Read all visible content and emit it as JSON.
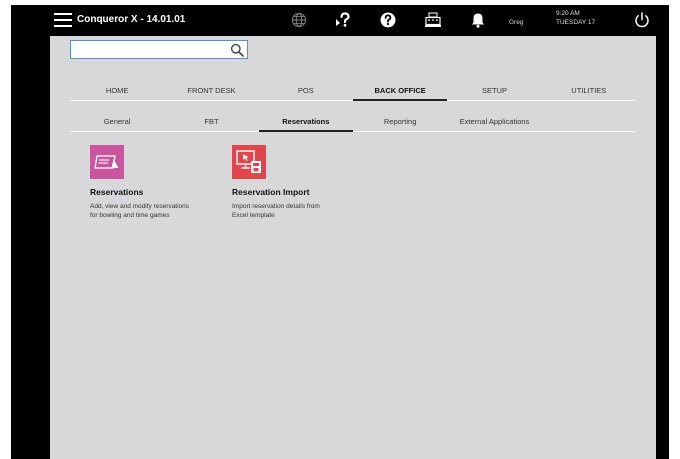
{
  "app": {
    "title": "Conqueror X - 14.01.01"
  },
  "topbar": {
    "user_name": "Greg",
    "time": "9:20 AM",
    "day": "TUESDAY 17"
  },
  "search": {
    "value": "",
    "placeholder": ""
  },
  "main_nav": [
    {
      "label": "HOME",
      "active": false
    },
    {
      "label": "FRONT DESK",
      "active": false
    },
    {
      "label": "POS",
      "active": false
    },
    {
      "label": "BACK OFFICE",
      "active": true
    },
    {
      "label": "SETUP",
      "active": false
    },
    {
      "label": "UTILITIES",
      "active": false
    }
  ],
  "sub_nav": [
    {
      "label": "General",
      "active": false
    },
    {
      "label": "FBT",
      "active": false
    },
    {
      "label": "Reservations",
      "active": true
    },
    {
      "label": "Reporting",
      "active": false
    },
    {
      "label": "External Applications",
      "active": false
    }
  ],
  "tiles": [
    {
      "title": "Reservations",
      "desc_line1": "Add, view and modify reservations",
      "desc_line2": "for bowling and time games",
      "color": "#c9559f",
      "icon": "reservation-ticket-icon"
    },
    {
      "title": "Reservation Import",
      "desc_line1": "Import reservation details from",
      "desc_line2": "Excel template",
      "color": "#e0464c",
      "icon": "import-monitor-icon"
    }
  ],
  "colors": {
    "topbar_bg": "#000000",
    "panel_bg": "#d8d8da",
    "search_border": "#5a8fcf"
  }
}
